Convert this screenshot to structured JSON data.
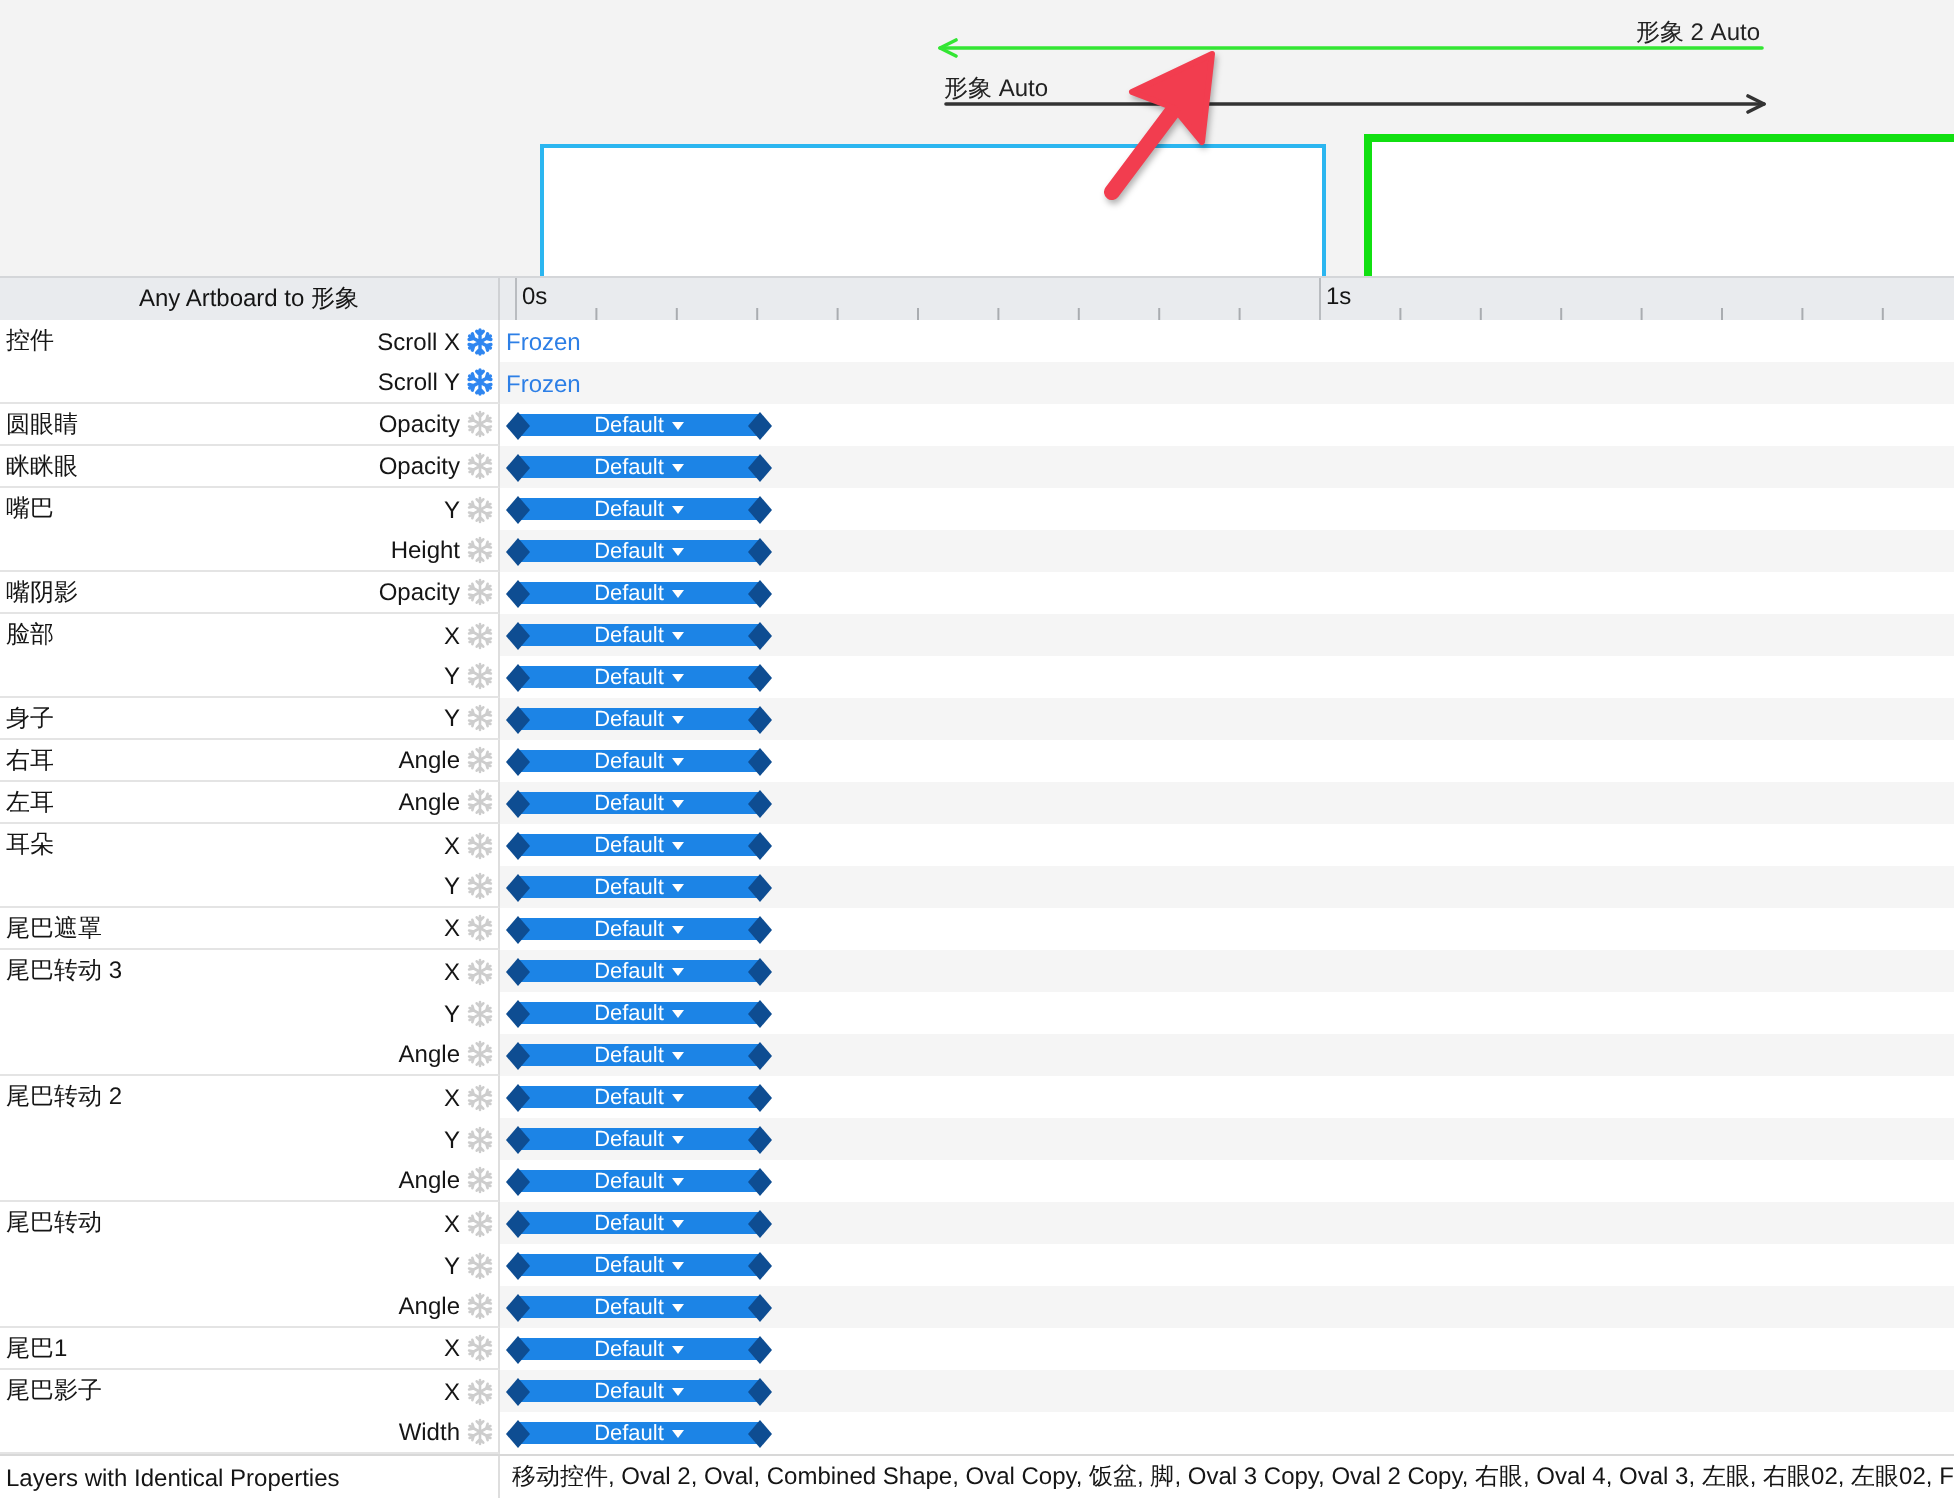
{
  "canvas": {
    "transitions": [
      {
        "label": "形象 2 Auto",
        "kind": "leftward",
        "color": "#33e633"
      },
      {
        "label": "形象 Auto",
        "kind": "rightward",
        "color": "#333333"
      }
    ],
    "artboards": [
      {
        "color": "#2bb6f0",
        "highlighted": false
      },
      {
        "color": "#11e011",
        "highlighted": true
      }
    ]
  },
  "timeline": {
    "title": "Any Artboard to 形象",
    "ruler": [
      "0s",
      "1s"
    ],
    "layers": [
      {
        "name": "控件",
        "properties": [
          {
            "name": "Scroll X",
            "kind": "frozen",
            "frozen": true,
            "value": "Frozen"
          },
          {
            "name": "Scroll Y",
            "kind": "frozen",
            "frozen": true,
            "value": "Frozen"
          }
        ]
      },
      {
        "name": "圆眼睛",
        "properties": [
          {
            "name": "Opacity",
            "kind": "curve",
            "frozen": false,
            "value": "Default"
          }
        ]
      },
      {
        "name": "眯眯眼",
        "properties": [
          {
            "name": "Opacity",
            "kind": "curve",
            "frozen": false,
            "value": "Default"
          }
        ]
      },
      {
        "name": "嘴巴",
        "properties": [
          {
            "name": "Y",
            "kind": "curve",
            "frozen": false,
            "value": "Default"
          },
          {
            "name": "Height",
            "kind": "curve",
            "frozen": false,
            "value": "Default"
          }
        ]
      },
      {
        "name": "嘴阴影",
        "properties": [
          {
            "name": "Opacity",
            "kind": "curve",
            "frozen": false,
            "value": "Default"
          }
        ]
      },
      {
        "name": "脸部",
        "properties": [
          {
            "name": "X",
            "kind": "curve",
            "frozen": false,
            "value": "Default"
          },
          {
            "name": "Y",
            "kind": "curve",
            "frozen": false,
            "value": "Default"
          }
        ]
      },
      {
        "name": "身子",
        "properties": [
          {
            "name": "Y",
            "kind": "curve",
            "frozen": false,
            "value": "Default"
          }
        ]
      },
      {
        "name": "右耳",
        "properties": [
          {
            "name": "Angle",
            "kind": "curve",
            "frozen": false,
            "value": "Default"
          }
        ]
      },
      {
        "name": "左耳",
        "properties": [
          {
            "name": "Angle",
            "kind": "curve",
            "frozen": false,
            "value": "Default"
          }
        ]
      },
      {
        "name": "耳朵",
        "properties": [
          {
            "name": "X",
            "kind": "curve",
            "frozen": false,
            "value": "Default"
          },
          {
            "name": "Y",
            "kind": "curve",
            "frozen": false,
            "value": "Default"
          }
        ]
      },
      {
        "name": "尾巴遮罩",
        "properties": [
          {
            "name": "X",
            "kind": "curve",
            "frozen": false,
            "value": "Default"
          }
        ]
      },
      {
        "name": "尾巴转动 3",
        "properties": [
          {
            "name": "X",
            "kind": "curve",
            "frozen": false,
            "value": "Default"
          },
          {
            "name": "Y",
            "kind": "curve",
            "frozen": false,
            "value": "Default"
          },
          {
            "name": "Angle",
            "kind": "curve",
            "frozen": false,
            "value": "Default"
          }
        ]
      },
      {
        "name": "尾巴转动 2",
        "properties": [
          {
            "name": "X",
            "kind": "curve",
            "frozen": false,
            "value": "Default"
          },
          {
            "name": "Y",
            "kind": "curve",
            "frozen": false,
            "value": "Default"
          },
          {
            "name": "Angle",
            "kind": "curve",
            "frozen": false,
            "value": "Default"
          }
        ]
      },
      {
        "name": "尾巴转动",
        "properties": [
          {
            "name": "X",
            "kind": "curve",
            "frozen": false,
            "value": "Default"
          },
          {
            "name": "Y",
            "kind": "curve",
            "frozen": false,
            "value": "Default"
          },
          {
            "name": "Angle",
            "kind": "curve",
            "frozen": false,
            "value": "Default"
          }
        ]
      },
      {
        "name": "尾巴1",
        "properties": [
          {
            "name": "X",
            "kind": "curve",
            "frozen": false,
            "value": "Default"
          }
        ]
      },
      {
        "name": "尾巴影子",
        "properties": [
          {
            "name": "X",
            "kind": "curve",
            "frozen": false,
            "value": "Default"
          },
          {
            "name": "Width",
            "kind": "curve",
            "frozen": false,
            "value": "Default"
          }
        ]
      }
    ]
  },
  "footer": {
    "label": "Layers with Identical Properties",
    "value": "移动控件, Oval 2, Oval, Combined Shape, Oval Copy, 饭盆, 脚, Oval 3 Copy, Oval 2 Copy, 右眼, Oval 4, Oval 3, 左眼, 右眼02, 左眼02, F"
  }
}
